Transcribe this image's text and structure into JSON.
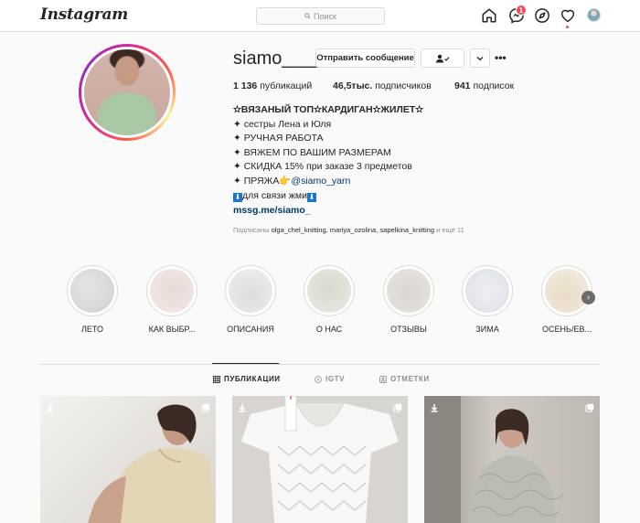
{
  "nav": {
    "logo": "Instagram",
    "search_placeholder": "Поиск",
    "notifications_count": "1",
    "icons": [
      "home-icon",
      "messenger-icon",
      "explore-icon",
      "heart-icon",
      "profile-avatar"
    ]
  },
  "profile": {
    "username": "siamo____",
    "message_button": "Отправить сообщение",
    "follow_button_icon": "person-check-icon",
    "more_button_icon": "chevron-down-icon",
    "options_icon": "•••",
    "stats": {
      "posts_count": "1 136",
      "posts_label": "публикаций",
      "followers_count": "46,5тыс.",
      "followers_label": "подписчиков",
      "following_count": "941",
      "following_label": "подписок"
    },
    "bio": {
      "line1": "✫ВЯЗАНЫЙ ТОП✫КАРДИГАН✫ЖИЛЕТ✫",
      "line2": "✦ сестры Лена и Юля",
      "line3": "✦ РУЧНАЯ РАБОТА",
      "line4": "✦ ВЯЖЕМ ПО ВАШИМ РАЗМЕРАМ",
      "line5": "✦ СКИДКА 15% при заказе 3 предметов",
      "line6_prefix": "✦ ПРЯЖА",
      "line6_emoji": "👉",
      "line6_mention": "@siamo_yarn",
      "line7_box": "⬇",
      "line7_text": "для связи жми",
      "line7_box2": "⬇"
    },
    "link": "mssg.me/siamo_",
    "followed_by": {
      "prefix": "Подписаны",
      "users": "olga_chel_knitting, mariya_ozolina, sapelkina_knitting",
      "suffix": "и ещё 11"
    }
  },
  "highlights": [
    {
      "label": "ЛЕТО"
    },
    {
      "label": "КАК ВЫБР..."
    },
    {
      "label": "ОПИСАНИЯ"
    },
    {
      "label": "О НАС"
    },
    {
      "label": "ОТЗЫВЫ"
    },
    {
      "label": "ЗИМА"
    },
    {
      "label": "ОСЕНЬ/ЕВ..."
    }
  ],
  "tabs": [
    {
      "label": "ПУБЛИКАЦИИ",
      "icon": "grid-icon",
      "active": true
    },
    {
      "label": "IGTV",
      "icon": "igtv-icon",
      "active": false
    },
    {
      "label": "ОТМЕТКИ",
      "icon": "tag-icon",
      "active": false
    }
  ],
  "colors": {
    "accent": "#0095f6",
    "badge": "#ed4956",
    "link": "#00376b",
    "muted": "#8e8e8e"
  }
}
